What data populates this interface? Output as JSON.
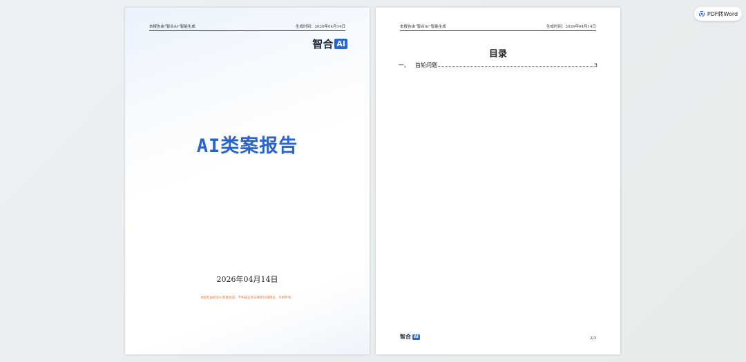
{
  "header": {
    "left": "本报告由“智合AI”智能生成",
    "right": "生成时间：2026年04月14日"
  },
  "logo": {
    "text": "智合",
    "badge": "AI"
  },
  "cover": {
    "title": "AI类案报告",
    "date": "2026年04月14日",
    "disclaimer": "本报告由智合AI智能生成，不构成正式法律意见或建议，仅供参考。"
  },
  "toc": {
    "title": "目录",
    "items": [
      {
        "num": "一、",
        "label": "首轮问题",
        "page": "3"
      }
    ]
  },
  "page_number": "2/3",
  "pdf_button": {
    "label": "PDF转Word"
  },
  "colors": {
    "accent": "#2b64c8",
    "badge": "#2a65d6",
    "disclaimer": "#e07a3a"
  }
}
